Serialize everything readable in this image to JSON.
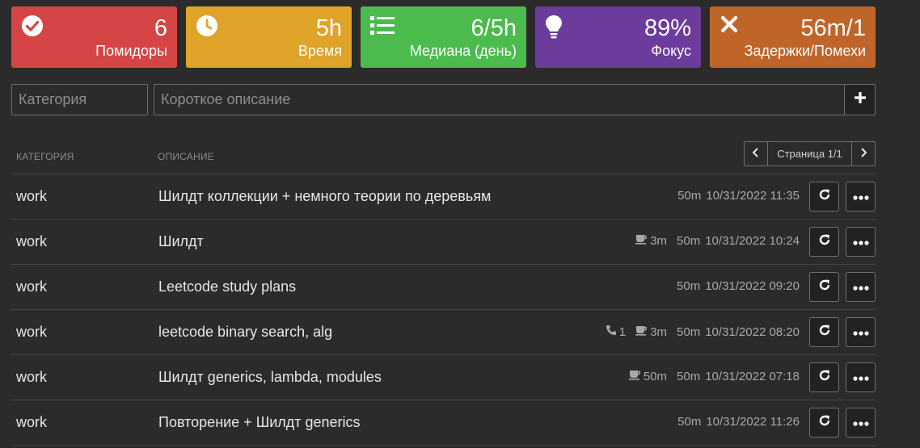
{
  "stats": [
    {
      "value": "6",
      "label": "Помидоры",
      "icon": "check-circle-icon",
      "color": "#d64545"
    },
    {
      "value": "5h",
      "label": "Время",
      "icon": "clock-icon",
      "color": "#e0a32a"
    },
    {
      "value": "6/5h",
      "label": "Медиана (день)",
      "icon": "list-icon",
      "color": "#4cbb4e"
    },
    {
      "value": "89%",
      "label": "Фокус",
      "icon": "lightbulb-icon",
      "color": "#6c3c9c"
    },
    {
      "value": "56m/1",
      "label": "Задержки/Помехи",
      "icon": "close-icon",
      "color": "#c0652a"
    }
  ],
  "form": {
    "category_placeholder": "Категория",
    "description_placeholder": "Короткое описание"
  },
  "table": {
    "col_category": "Категория",
    "col_description": "Описание",
    "page_label": "Страница 1/1"
  },
  "rows": [
    {
      "category": "work",
      "description": "Шилдт коллекции + немного теории по деревьям",
      "phone": "",
      "coffee": "",
      "duration": "50m",
      "datetime": "10/31/2022 11:35"
    },
    {
      "category": "work",
      "description": "Шилдт",
      "phone": "",
      "coffee": "3m",
      "duration": "50m",
      "datetime": "10/31/2022 10:24"
    },
    {
      "category": "work",
      "description": "Leetcode study plans",
      "phone": "",
      "coffee": "",
      "duration": "50m",
      "datetime": "10/31/2022 09:20"
    },
    {
      "category": "work",
      "description": "leetcode binary search, alg",
      "phone": "1",
      "coffee": "3m",
      "duration": "50m",
      "datetime": "10/31/2022 08:20"
    },
    {
      "category": "work",
      "description": "Шилдт generics, lambda, modules",
      "phone": "",
      "coffee": "50m",
      "duration": "50m",
      "datetime": "10/31/2022 07:18"
    },
    {
      "category": "work",
      "description": "Повторение + Шилдт generics",
      "phone": "",
      "coffee": "",
      "duration": "50m",
      "datetime": "10/31/2022 11:26"
    }
  ]
}
